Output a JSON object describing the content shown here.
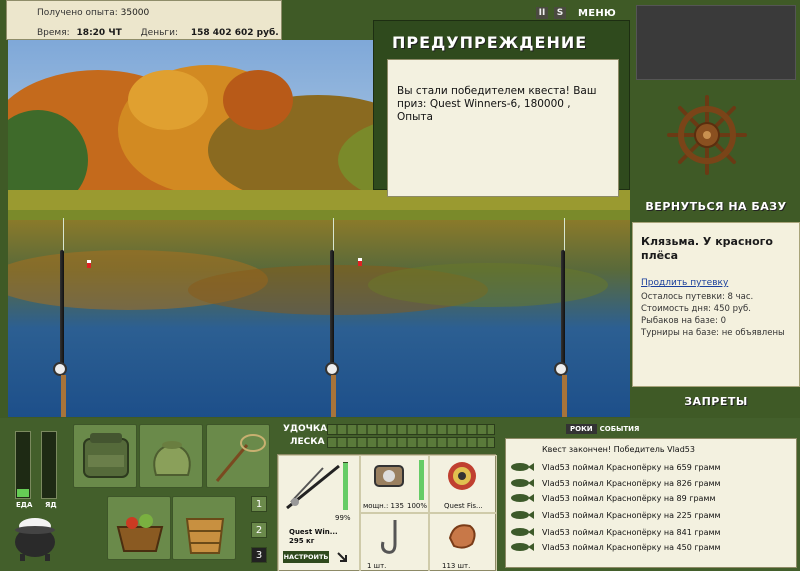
{
  "top": {
    "exp_label": "Получено опыта:",
    "exp_value": "35000",
    "time_label": "Время:",
    "time_value": "18:20 ЧТ",
    "money_label": "Деньги:",
    "money_value": "158 402 602 руб."
  },
  "toolbar": {
    "pause_label": "II",
    "sound_label": "S",
    "menu_label": "МЕНЮ"
  },
  "warning": {
    "title": "ПРЕДУПРЕЖДЕНИЕ",
    "message": "Вы стали победителем квеста! Ваш приз: Quest Winners-6, 180000 , Опыта"
  },
  "right": {
    "back_label": "ВЕРНУТЬСЯ НА БАЗУ",
    "location": "Клязьма. У красного плёса",
    "extend_link": "Продлить путевку",
    "days_left": "Осталось путевки: 8 час.",
    "day_cost": "Стоимость дня: 450 руб.",
    "fishers": "Рыбаков на базе: 0",
    "tournaments": "Турниры на базе: не объявлены",
    "bans_label": "ЗАПРЕТЫ"
  },
  "gauges": {
    "food_label": "ЕДА",
    "poison_label": "ЯД",
    "food_level": 0.12,
    "poison_level": 0.0
  },
  "pages": [
    "1",
    "2",
    "3"
  ],
  "bars": {
    "rod_label": "УДОЧКА",
    "line_label": "ЛЕСКА"
  },
  "tackle": {
    "rod_name": "Quest Win...",
    "rod_weight": "295 кг",
    "rod_percent": "99%",
    "reel_power": "мощн.: 135",
    "reel_percent": "100%",
    "line_name": "Quest Fis...",
    "hook_count": "1 шт.",
    "bait_count": "113 шт.",
    "setup_label": "НАСТРОИТЬ"
  },
  "events": {
    "tab_roki": "РОКИ",
    "tab_events": "СОБЫТИЯ",
    "header": "Квест закончен! Победитель Vlad53",
    "items": [
      "Vlad53 поймал Краснопёрку на 659 грамм",
      "Vlad53 поймал Краснопёрку на 826 грамм",
      "Vlad53 поймал Краснопёрку на 89 грамм",
      "Vlad53 поймал Краснопёрку на 225 грамм",
      "Vlad53 поймал Краснопёрку на 841 грамм",
      "Vlad53 поймал Краснопёрку на 450 грамм"
    ]
  },
  "colors": {
    "panel_green": "#435f2b",
    "dark_green": "#2f4a1d",
    "paper": "#f3f1e0"
  }
}
